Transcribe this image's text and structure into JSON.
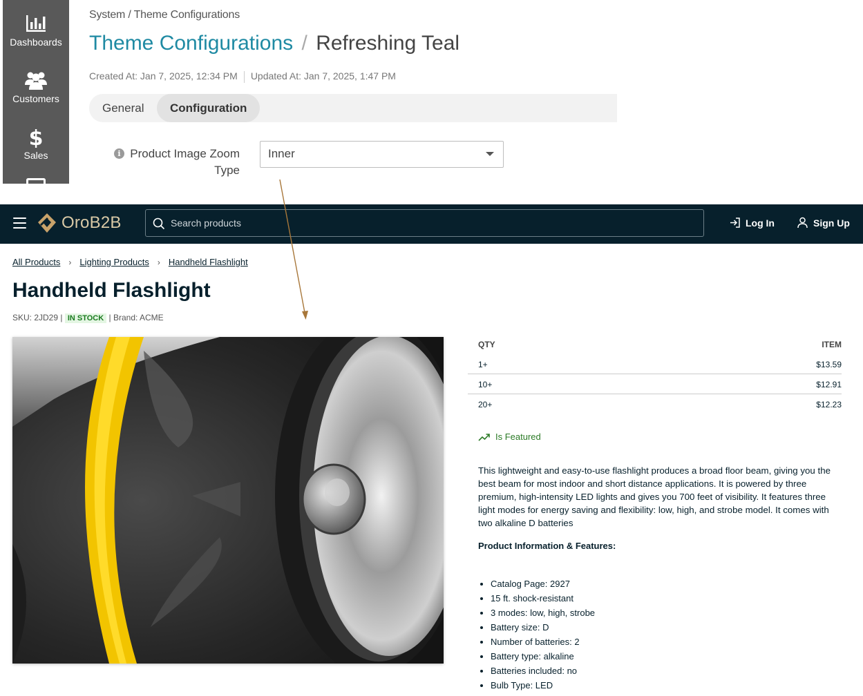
{
  "admin": {
    "sidebar": [
      {
        "label": "Dashboards",
        "icon": "bar-chart-icon"
      },
      {
        "label": "Customers",
        "icon": "users-icon"
      },
      {
        "label": "Sales",
        "icon": "dollar-icon"
      }
    ],
    "breadcrumb": "System / Theme Configurations",
    "title_primary": "Theme Configurations",
    "title_separator": "/",
    "title_secondary": "Refreshing Teal",
    "created_at": "Created At: Jan 7, 2025, 12:34 PM",
    "updated_at": "Updated At: Jan 7, 2025, 1:47 PM",
    "tabs": [
      {
        "label": "General",
        "active": false
      },
      {
        "label": "Configuration",
        "active": true
      }
    ],
    "field": {
      "label_line1": "Product Image Zoom",
      "label_line2": "Type",
      "value": "Inner"
    }
  },
  "store": {
    "logo_text": "OroB2B",
    "search_placeholder": "Search products",
    "login_label": "Log In",
    "signup_label": "Sign Up",
    "breadcrumbs": [
      "All Products",
      "Lighting Products",
      "Handheld Flashlight"
    ],
    "product_title": "Handheld Flashlight",
    "sku": "SKU: 2JD29",
    "stock_badge": "IN STOCK",
    "brand": "Brand: ACME",
    "price_header_qty": "QTY",
    "price_header_item": "ITEM",
    "prices": [
      {
        "qty": "1+",
        "price": "$13.59"
      },
      {
        "qty": "10+",
        "price": "$12.91"
      },
      {
        "qty": "20+",
        "price": "$12.23"
      }
    ],
    "featured_label": "Is Featured",
    "description": "This lightweight and easy-to-use flashlight produces a broad floor beam, giving you the best beam for most indoor and short distance applications. It is powered by three premium, high-intensity LED lights and gives you 700 feet of visibility. It features three light modes for energy saving and flexibility: low, high, and strobe model. It comes with two alkaline D batteries",
    "features_title": "Product Information & Features:",
    "features": [
      "Catalog Page: 2927",
      "15 ft. shock-resistant",
      "3 modes: low, high, strobe",
      "Battery size: D",
      "Number of batteries: 2",
      "Battery type: alkaline",
      "Batteries included: no",
      "Bulb Type: LED"
    ]
  },
  "colors": {
    "admin_sidebar": "#595959",
    "admin_title_accent": "#1f8aa3",
    "navbar": "#07202c",
    "logo_accent": "#c8a26a",
    "featured_green": "#2a7a25",
    "annotation_arrow": "#a8773a"
  }
}
